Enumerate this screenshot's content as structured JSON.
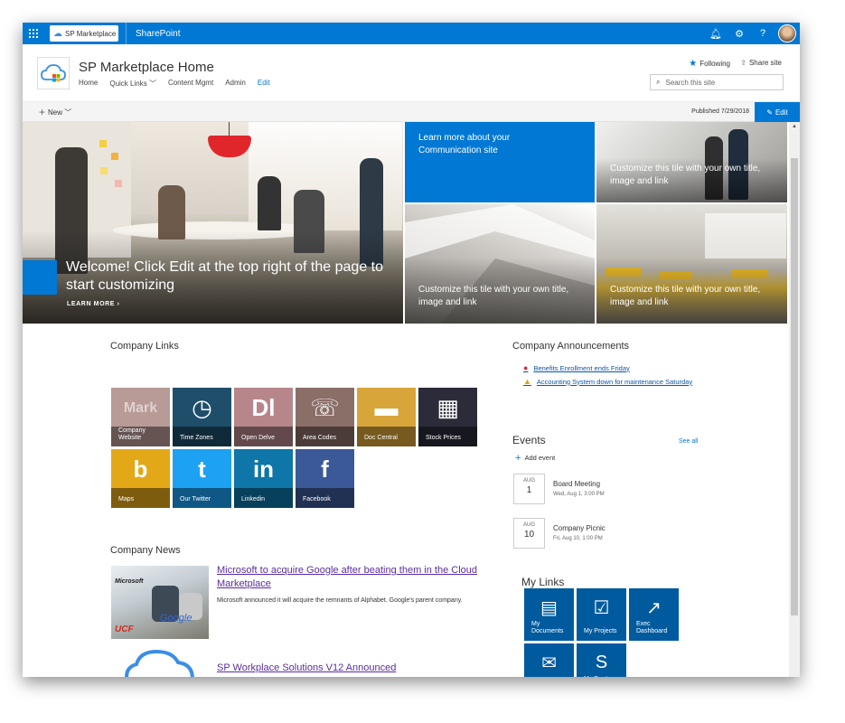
{
  "suite": {
    "brand": "SP Marketplace",
    "app": "SharePoint"
  },
  "site": {
    "title": "SP Marketplace Home",
    "nav": [
      "Home",
      "Quick Links",
      "Content Mgmt",
      "Admin",
      "Edit"
    ],
    "following": "Following",
    "share": "Share site",
    "search_placeholder": "Search this site"
  },
  "command": {
    "new": "New",
    "published": "Published 7/29/2018",
    "edit": "Edit"
  },
  "hero": {
    "main_text": "Welcome! Click Edit at the top right of the page to start customizing",
    "learn_more": "LEARN MORE",
    "tiles": [
      "Learn more about your Communication site",
      "Customize this tile with your own title, image and link",
      "Customize this tile with your own title, image and link",
      "Customize this tile with your own title, image and link"
    ]
  },
  "company_links": {
    "title": "Company Links",
    "items": [
      {
        "label": "Company Website",
        "color": "#b89a96",
        "icon": "website-icon"
      },
      {
        "label": "Time Zones",
        "color": "#1f4e6b",
        "icon": "clock-icon"
      },
      {
        "label": "Open Delve",
        "color": "#b7868a",
        "icon": "delve-icon"
      },
      {
        "label": "Area Codes",
        "color": "#8a6e68",
        "icon": "phone-icon"
      },
      {
        "label": "Doc Central",
        "color": "#d8a53a",
        "icon": "folder-icon"
      },
      {
        "label": "Stock Prices",
        "color": "#2b2b3a",
        "icon": "stock-icon"
      },
      {
        "label": "Maps",
        "color": "#e3a818",
        "icon": "bing-icon"
      },
      {
        "label": "Our Twitter",
        "color": "#1da1f2",
        "icon": "twitter-icon"
      },
      {
        "label": "Linkedin",
        "color": "#0e76a8",
        "icon": "linkedin-icon"
      },
      {
        "label": "Facebook",
        "color": "#3b5998",
        "icon": "facebook-icon"
      }
    ]
  },
  "company_news": {
    "title": "Company News",
    "items": [
      {
        "headline": "Microsoft to acquire Google after beating them in the Cloud Marketplace",
        "summary": "Microsoft announced it will acquire the remnants of Alphabet. Google's parent company."
      },
      {
        "headline": "SP Workplace Solutions V12 Announced"
      }
    ],
    "img_text": {
      "microsoft": "Microsoft",
      "google": "Google",
      "ucf": "UCF"
    }
  },
  "announcements": {
    "title": "Company Announcements",
    "items": [
      {
        "text": "Benefits Enrollment ends Friday",
        "icon": "error-icon"
      },
      {
        "text": "Accounting System down for maintenance Saturday",
        "icon": "warning-icon"
      }
    ]
  },
  "events": {
    "title": "Events",
    "see_all": "See all",
    "add": "Add event",
    "items": [
      {
        "month": "AUG",
        "day": "1",
        "name": "Board Meeting",
        "time": "Wed, Aug 1, 3:00 PM"
      },
      {
        "month": "AUG",
        "day": "10",
        "name": "Company Picnic",
        "time": "Fri, Aug 10, 1:00 PM"
      }
    ]
  },
  "my_links": {
    "title": "My Links",
    "items": [
      {
        "label": "My Documents",
        "icon": "document-icon"
      },
      {
        "label": "My Projects",
        "icon": "checklist-icon"
      },
      {
        "label": "Exec Dashboard",
        "icon": "chart-icon"
      },
      {
        "label": "My Email",
        "icon": "mail-icon"
      },
      {
        "label": "My Dept Portal",
        "icon": "sharepoint-icon"
      }
    ]
  },
  "colors": {
    "accent": "#0078d4"
  }
}
